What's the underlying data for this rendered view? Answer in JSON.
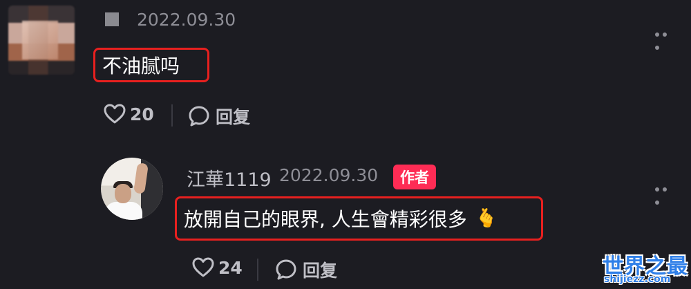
{
  "comment": {
    "date": "2022.09.30",
    "text": "不油腻吗",
    "likes": "20",
    "reply_label": "回复"
  },
  "reply": {
    "author": "江華1119",
    "date": "2022.09.30",
    "badge": "作者",
    "text": "放開自己的眼界, 人生會精彩很多",
    "emoji": "🫰",
    "likes": "24",
    "reply_label": "回复"
  },
  "watermark": {
    "title": "世界之最",
    "url": "shijiezz.com"
  },
  "icons": {
    "like": "heart-outline-icon",
    "reply": "speech-bubble-icon",
    "more": "more-dots-icon"
  },
  "colors": {
    "background": "#1c1c22",
    "highlight_border": "#e8201f",
    "author_badge": "#fe2c55",
    "secondary_text": "#8e8e96"
  }
}
